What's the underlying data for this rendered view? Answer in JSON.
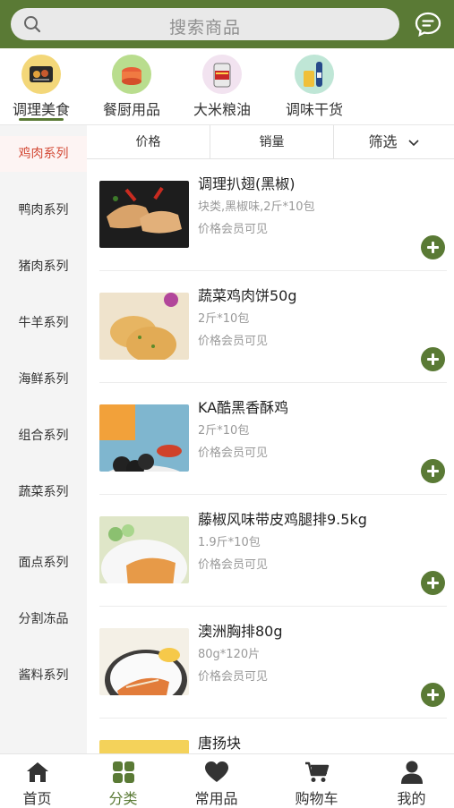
{
  "search": {
    "placeholder": "搜索商品"
  },
  "categories": [
    {
      "label": "调理美食",
      "active": true,
      "icon": "prepared-food-icon"
    },
    {
      "label": "餐厨用品",
      "active": false,
      "icon": "kitchenware-icon"
    },
    {
      "label": "大米粮油",
      "active": false,
      "icon": "rice-oil-icon"
    },
    {
      "label": "调味干货",
      "active": false,
      "icon": "seasoning-icon"
    }
  ],
  "sidebar": {
    "items": [
      {
        "label": "鸡肉系列",
        "active": true
      },
      {
        "label": "鸭肉系列"
      },
      {
        "label": "猪肉系列"
      },
      {
        "label": "牛羊系列"
      },
      {
        "label": "海鲜系列"
      },
      {
        "label": "组合系列"
      },
      {
        "label": "蔬菜系列"
      },
      {
        "label": "面点系列"
      },
      {
        "label": "分割冻品"
      },
      {
        "label": "酱料系列"
      }
    ]
  },
  "sort": {
    "price": "价格",
    "sales": "销量",
    "filter": "筛选"
  },
  "products": [
    {
      "name": "调理扒翅(黑椒)",
      "spec": "块类,黑椒味,2斤*10包",
      "price": "价格会员可见"
    },
    {
      "name": "蔬菜鸡肉饼50g",
      "spec": "2斤*10包",
      "price": "价格会员可见"
    },
    {
      "name": "KA酷黑香酥鸡",
      "spec": "2斤*10包",
      "price": "价格会员可见"
    },
    {
      "name": "藤椒风味带皮鸡腿排9.5kg",
      "spec": "1.9斤*10包",
      "price": "价格会员可见"
    },
    {
      "name": "澳洲胸排80g",
      "spec": "80g*120片",
      "price": "价格会员可见"
    },
    {
      "name": "唐扬块",
      "spec": "",
      "price": ""
    }
  ],
  "nav": [
    {
      "label": "首页",
      "icon": "home-icon"
    },
    {
      "label": "分类",
      "icon": "grid-icon",
      "active": true
    },
    {
      "label": "常用品",
      "icon": "heart-icon"
    },
    {
      "label": "购物车",
      "icon": "cart-icon"
    },
    {
      "label": "我的",
      "icon": "user-icon"
    }
  ],
  "colors": {
    "brand": "#5a7a35",
    "activeSide": "#d34a36",
    "muted": "#999999"
  }
}
